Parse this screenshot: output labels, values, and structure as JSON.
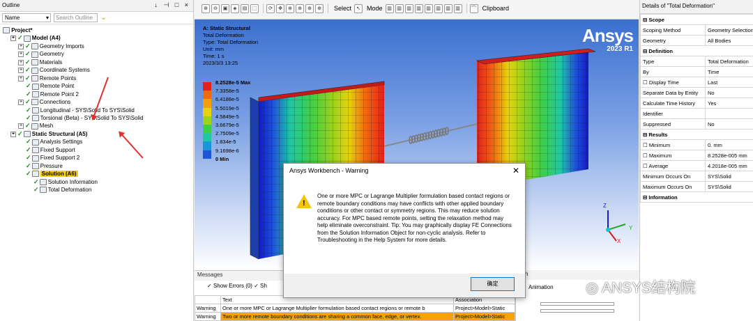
{
  "outline": {
    "title": "Outline",
    "name_label": "Name",
    "search_placeholder": "Search Outline",
    "window_buttons": "↓ ⊣ □ ×",
    "tree": [
      {
        "label": "Project*",
        "indent": 0,
        "bold": true
      },
      {
        "label": "Model (A4)",
        "indent": 1,
        "bold": true
      },
      {
        "label": "Geometry Imports",
        "indent": 2
      },
      {
        "label": "Geometry",
        "indent": 2
      },
      {
        "label": "Materials",
        "indent": 2
      },
      {
        "label": "Coordinate Systems",
        "indent": 2
      },
      {
        "label": "Remote Points",
        "indent": 2
      },
      {
        "label": "Remote Point",
        "indent": 3
      },
      {
        "label": "Remote Point 2",
        "indent": 3
      },
      {
        "label": "Connections",
        "indent": 2
      },
      {
        "label": "Longitudinal - SYS\\Solid To SYS\\Solid",
        "indent": 3
      },
      {
        "label": "Torsional (Beta) - SYS\\Solid To SYS\\Solid",
        "indent": 3
      },
      {
        "label": "Mesh",
        "indent": 2
      },
      {
        "label": "Static Structural (A5)",
        "indent": 1,
        "bold": true
      },
      {
        "label": "Analysis Settings",
        "indent": 3
      },
      {
        "label": "Fixed Support",
        "indent": 3
      },
      {
        "label": "Fixed Support 2",
        "indent": 3
      },
      {
        "label": "Pressure",
        "indent": 3
      },
      {
        "label": "Solution (A6)",
        "indent": 3,
        "bold": true,
        "highlight": true
      },
      {
        "label": "Solution Information",
        "indent": 4
      },
      {
        "label": "Total Deformation",
        "indent": 4
      }
    ]
  },
  "toolbar": {
    "select_label": "Select",
    "mode_label": "Mode",
    "clipboard_label": "Clipboard"
  },
  "viewport": {
    "info": [
      "A: Static Structural",
      "Total Deformation",
      "Type: Total Deformation",
      "Unit: mm",
      "Time: 1 s",
      "2023/3/3 13:25"
    ],
    "legend": [
      "8.2528e-5 Max",
      "7.3358e-5",
      "6.4188e-5",
      "5.5019e-5",
      "4.5849e-5",
      "3.6679e-5",
      "2.7509e-5",
      "1.834e-5",
      "9.1698e-6",
      "0 Min"
    ],
    "legend_colors": [
      "#e2201c",
      "#f06a10",
      "#f3a010",
      "#e6d20e",
      "#9fd21a",
      "#3fcf45",
      "#1fc7a4",
      "#1796d8",
      "#1f55d8",
      "#1418c8"
    ],
    "logo": "Ansys",
    "logo_release": "2023 R1",
    "axis_labels": [
      "Z",
      "Y",
      "X"
    ]
  },
  "messages": {
    "header": "Messages",
    "show_errors_label": "Show Errors",
    "errors_count": "(0)",
    "cut_label": "Sh",
    "columns": [
      "Text",
      "Association"
    ],
    "rows": [
      {
        "type": "Warning",
        "text": "One or more MPC or Lagrange Multiplier formulation based contact regions or remote b",
        "assoc": "Project>Model>Static"
      },
      {
        "type": "Warning",
        "text": "Two or more remote boundary conditions are sharing a common face, edge, or vertex.",
        "assoc": "Project>Model>Static"
      }
    ]
  },
  "graph": {
    "header": "aph",
    "animation_label": "Animation"
  },
  "details": {
    "title": "Details of \"Total Deformation\"",
    "rows": [
      {
        "section": "Scope"
      },
      {
        "key": "Scoping Method",
        "value": "Geometry Selection"
      },
      {
        "key": "Geometry",
        "value": "All Bodies"
      },
      {
        "section": "Definition"
      },
      {
        "key": "Type",
        "value": "Total Deformation"
      },
      {
        "key": "By",
        "value": "Time"
      },
      {
        "key": "Display Time",
        "value": "Last",
        "checkbox": true
      },
      {
        "key": "Separate Data by Entity",
        "value": "No"
      },
      {
        "key": "Calculate Time History",
        "value": "Yes"
      },
      {
        "key": "Identifier",
        "value": ""
      },
      {
        "key": "Suppressed",
        "value": "No"
      },
      {
        "section": "Results"
      },
      {
        "key": "Minimum",
        "value": "0. mm",
        "checkbox": true
      },
      {
        "key": "Maximum",
        "value": "8.2528e-005 mm",
        "checkbox": true
      },
      {
        "key": "Average",
        "value": "4.2018e-005 mm",
        "checkbox": true
      },
      {
        "key": "Minimum Occurs On",
        "value": "SYS\\Solid"
      },
      {
        "key": "Maximum Occurs On",
        "value": "SYS\\Solid"
      },
      {
        "section": "Information"
      }
    ]
  },
  "dialog": {
    "title": "Ansys Workbench - Warning",
    "message": "One or more MPC or Lagrange Multiplier formulation based contact regions or remote boundary conditions may have conflicts with other applied boundary conditions or other contact or symmetry regions. This may reduce solution accuracy. For MPC based remote points, setting the relaxation method may help eliminate overconstraint. Tip: You may graphically display FE Connections from the Solution Information Object for non-cyclic analysis. Refer to Troubleshooting in the Help System for more details.",
    "ok_label": "确定"
  },
  "watermark": "ANSYS结构院"
}
